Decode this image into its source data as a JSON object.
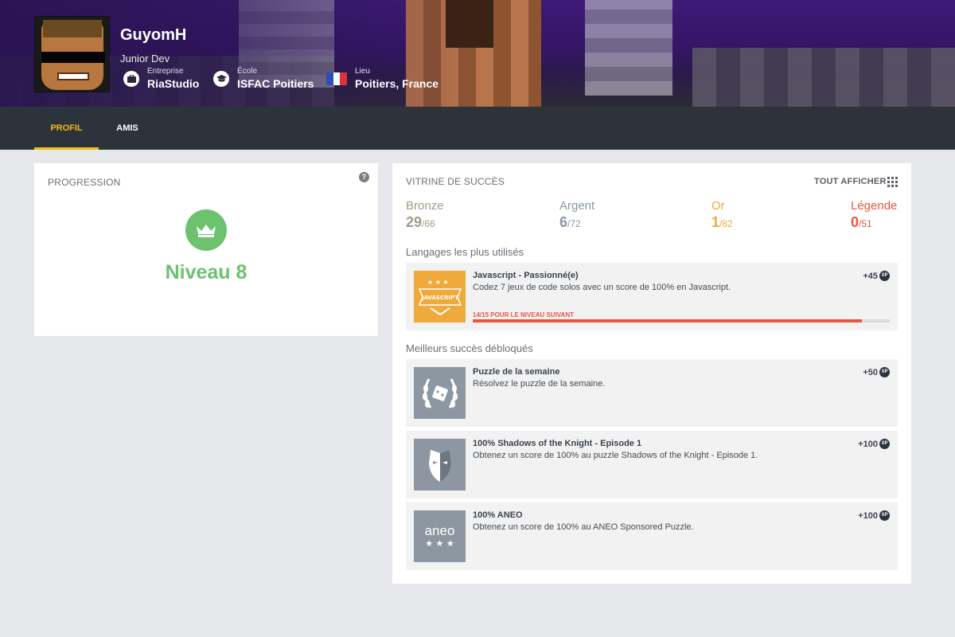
{
  "profile": {
    "name": "GuyomH",
    "role": "Junior Dev",
    "company": {
      "label": "Entreprise",
      "value": "RiaStudio",
      "icon": "briefcase-icon"
    },
    "school": {
      "label": "École",
      "value": "ISFAC Poitiers",
      "icon": "graduation-cap-icon"
    },
    "location": {
      "label": "Lieu",
      "value": "Poitiers, France",
      "icon": "france-flag-icon"
    }
  },
  "tabs": [
    {
      "label": "PROFIL",
      "active": true
    },
    {
      "label": "AMIS",
      "active": false
    }
  ],
  "progression": {
    "title": "PROGRESSION",
    "help": "?",
    "level_text": "Niveau 8",
    "color": "#6cc26e"
  },
  "showcase": {
    "title": "VITRINE DE SUCCÈS",
    "show_all": "TOUT AFFICHER",
    "tiers": [
      {
        "name": "Bronze",
        "count": "29",
        "total": "/66",
        "color": "#a4998c"
      },
      {
        "name": "Argent",
        "count": "6",
        "total": "/72",
        "color": "#8c97a6"
      },
      {
        "name": "Or",
        "count": "1",
        "total": "/82",
        "color": "#f2a83a"
      },
      {
        "name": "Légende",
        "count": "0",
        "total": "/51",
        "color": "#e8563f"
      }
    ],
    "languages_label": "Langages les plus utilisés",
    "language_achievement": {
      "name": "Javascript - Passionné(e)",
      "description": "Codez 7 jeux de code solos avec un score de 100% en Javascript.",
      "xp": "+45",
      "progress_text": "14/15 POUR LE NIVEAU SUIVANT",
      "progress": 0.933,
      "badge_text": "JAVASCRIPT",
      "badge_color": "#f0a93b"
    },
    "best_label": "Meilleurs succès débloqués",
    "best_achievements": [
      {
        "name": "Puzzle de la semaine",
        "description": "Résolvez le puzzle de la semaine.",
        "xp": "+50",
        "icon": "laurel-dice-icon"
      },
      {
        "name": "100% Shadows of the Knight - Episode 1",
        "description": "Obtenez un score de 100% au puzzle Shadows of the Knight - Episode 1.",
        "xp": "+100",
        "icon": "mask-icon"
      },
      {
        "name": "100% ANEO",
        "description": "Obtenez un score de 100% au ANEO Sponsored Puzzle.",
        "xp": "+100",
        "icon": "aneo-logo-icon",
        "badge_text": "aneo"
      }
    ],
    "xp_unit": "XP"
  },
  "colors": {
    "accent": "#f2bb13",
    "tabs_bg": "#2d333b",
    "badge_gray": "#8c97a1"
  }
}
